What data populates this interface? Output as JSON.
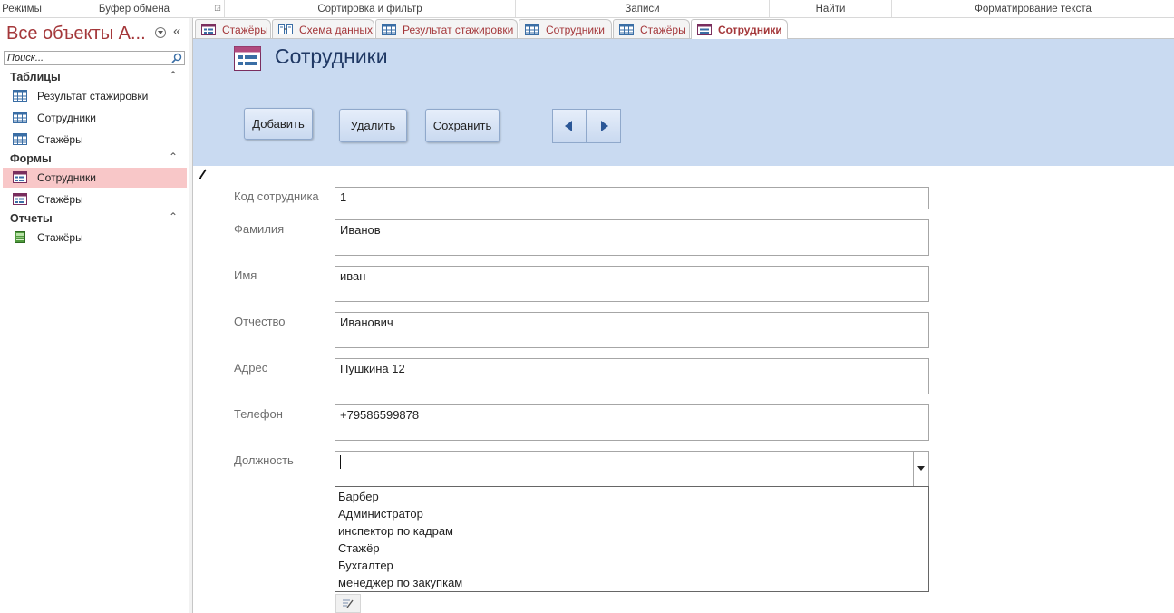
{
  "ribbon": {
    "groups": [
      "Режимы",
      "Буфер обмена",
      "Сортировка и фильтр",
      "Записи",
      "Найти",
      "Форматирование текста"
    ]
  },
  "nav": {
    "title": "Все объекты A...",
    "search_placeholder": "Поиск...",
    "sections": [
      {
        "label": "Таблицы",
        "items": [
          "Результат стажировки",
          "Сотрудники",
          "Стажёры"
        ]
      },
      {
        "label": "Формы",
        "items": [
          "Сотрудники",
          "Стажёры"
        ]
      },
      {
        "label": "Отчеты",
        "items": [
          "Стажёры"
        ]
      }
    ],
    "selected": "Формы / Сотрудники",
    "collapse_glyph": "«",
    "section_toggle_glyph": "⌃"
  },
  "tabs": [
    {
      "label": "Стажёры",
      "icon": "form-icon"
    },
    {
      "label": "Схема данных",
      "icon": "relationships-icon"
    },
    {
      "label": "Результат стажировки",
      "icon": "table-icon"
    },
    {
      "label": "Сотрудники",
      "icon": "table-icon"
    },
    {
      "label": "Стажёры",
      "icon": "table-icon"
    },
    {
      "label": "Сотрудники",
      "icon": "form-icon",
      "active": true
    }
  ],
  "form": {
    "title": "Сотрудники",
    "buttons": {
      "add": "Добавить",
      "delete": "Удалить",
      "save": "Сохранить"
    },
    "fields": [
      {
        "label": "Код сотрудника",
        "value": "1"
      },
      {
        "label": "Фамилия",
        "value": "Иванов"
      },
      {
        "label": "Имя",
        "value": "иван"
      },
      {
        "label": "Отчество",
        "value": "Иванович"
      },
      {
        "label": "Адрес",
        "value": "Пушкина 12"
      },
      {
        "label": "Телефон",
        "value": "+79586599878"
      },
      {
        "label": "Должность",
        "value": ""
      }
    ],
    "position_options": [
      "Барбер",
      "Администратор",
      "инспектор по кадрам",
      "Стажёр",
      "Бухгалтер",
      "менеджер по закупкам"
    ]
  },
  "colors": {
    "accent": "#a4373a",
    "header_bg": "#c9daf1",
    "selected_nav": "#f8c7c8",
    "title_text": "#1f3864"
  }
}
